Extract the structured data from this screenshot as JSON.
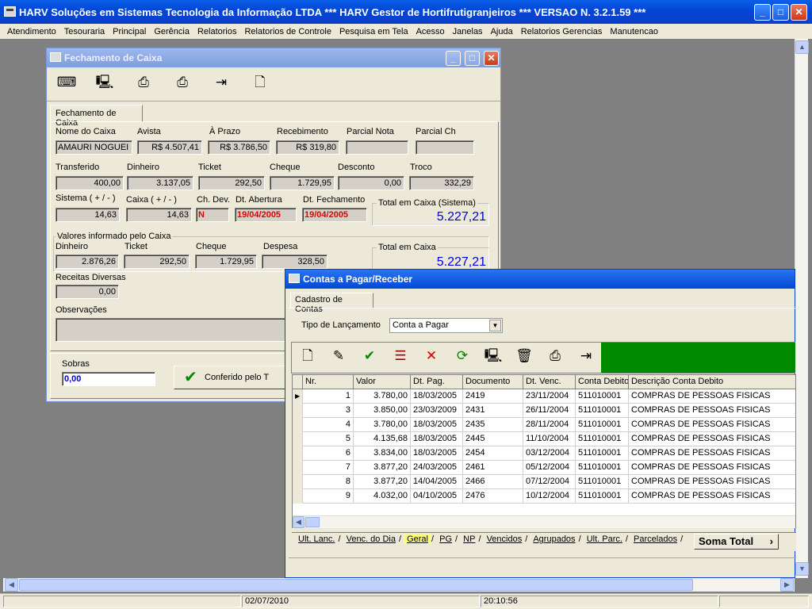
{
  "app": {
    "title": "HARV Soluções em Sistemas Tecnologia da Informação LTDA *** HARV Gestor de Hortifrutigranjeiros *** VERSAO N. 3.2.1.59 ***",
    "min_label": "_",
    "max_label": "□",
    "close_label": "✕"
  },
  "menu": [
    "Atendimento",
    "Tesouraria",
    "Principal",
    "Gerência",
    "Relatorios",
    "Relatorios de Controle",
    "Pesquisa em Tela",
    "Acesso",
    "Janelas",
    "Ajuda",
    "Relatorios Gerencias",
    "Manutencao"
  ],
  "fechamento": {
    "title": "Fechamento de Caixa",
    "tab": "Fechamento de Caixa",
    "labels": {
      "nome_caixa": "Nome do Caixa",
      "avista": "Avista",
      "aprazo": "À Prazo",
      "recebimento": "Recebimento",
      "parcial_nota": "Parcial Nota",
      "parcial_ch": "Parcial Ch",
      "transferido": "Transferido",
      "dinheiro": "Dinheiro",
      "ticket": "Ticket",
      "cheque": "Cheque",
      "desconto": "Desconto",
      "troco": "Troco",
      "sistema": "Sistema ( + / - )",
      "caixa": "Caixa ( + / - )",
      "ch_dev": "Ch. Dev.",
      "dt_abertura": "Dt. Abertura",
      "dt_fechamento": "Dt. Fechamento",
      "total_sistema": "Total em Caixa (Sistema)",
      "valores_info": "Valores informado pelo Caixa",
      "v_dinheiro": "Dinheiro",
      "v_ticket": "Ticket",
      "v_cheque": "Cheque",
      "v_despesa": "Despesa",
      "total_caixa": "Total em Caixa",
      "receitas": "Receitas Diversas",
      "observacoes": "Observações",
      "sobras": "Sobras"
    },
    "values": {
      "nome_caixa": "AMAURI NOGUEI",
      "avista": "R$ 4.507,41",
      "aprazo": "R$ 3.786,50",
      "recebimento": "R$ 319,80",
      "parcial_nota": "",
      "parcial_ch": "",
      "transferido": "400,00",
      "dinheiro": "3.137,05",
      "ticket": "292,50",
      "cheque": "1.729,95",
      "desconto": "0,00",
      "troco": "332,29",
      "sistema": "14,63",
      "caixa": "14,63",
      "ch_dev": "N",
      "dt_abertura": "19/04/2005",
      "dt_fechamento": "19/04/2005",
      "total_sistema": "5.227,21",
      "v_dinheiro": "2.876,26",
      "v_ticket": "292,50",
      "v_cheque": "1.729,95",
      "v_despesa": "328,50",
      "total_caixa": "5.227,21",
      "receitas": "0,00",
      "observacoes": "",
      "sobras": "0,00"
    },
    "conferido_label": "Conferido pelo T"
  },
  "contas": {
    "title": "Contas a Pagar/Receber",
    "tab": "Cadastro de Contas",
    "tipo_label": "Tipo de Lançamento",
    "tipo_value": "Conta a Pagar",
    "columns": [
      "Nr.",
      "Valor",
      "Dt. Pag.",
      "Documento",
      "Dt. Venc.",
      "Conta Debito",
      "Descrição Conta Debito"
    ],
    "rows": [
      [
        "1",
        "3.780,00",
        "18/03/2005",
        "2419",
        "23/11/2004",
        "511010001",
        "COMPRAS DE PESSOAS FISICAS"
      ],
      [
        "3",
        "3.850,00",
        "23/03/2009",
        "2431",
        "26/11/2004",
        "511010001",
        "COMPRAS DE PESSOAS FISICAS"
      ],
      [
        "4",
        "3.780,00",
        "18/03/2005",
        "2435",
        "28/11/2004",
        "511010001",
        "COMPRAS DE PESSOAS FISICAS"
      ],
      [
        "5",
        "4.135,68",
        "18/03/2005",
        "2445",
        "11/10/2004",
        "511010001",
        "COMPRAS DE PESSOAS FISICAS"
      ],
      [
        "6",
        "3.834,00",
        "18/03/2005",
        "2454",
        "03/12/2004",
        "511010001",
        "COMPRAS DE PESSOAS FISICAS"
      ],
      [
        "7",
        "3.877,20",
        "24/03/2005",
        "2461",
        "05/12/2004",
        "511010001",
        "COMPRAS DE PESSOAS FISICAS"
      ],
      [
        "8",
        "3.877,20",
        "14/04/2005",
        "2466",
        "07/12/2004",
        "511010001",
        "COMPRAS DE PESSOAS FISICAS"
      ],
      [
        "9",
        "4.032,00",
        "04/10/2005",
        "2476",
        "10/12/2004",
        "511010001",
        "COMPRAS DE PESSOAS FISICAS"
      ]
    ],
    "bottom_tabs": [
      "Ult. Lanc.",
      "Venc. do Dia",
      "Geral",
      "PG",
      "NP",
      "Vencidos",
      "Agrupados",
      "Ult. Parc.",
      "Parcelados"
    ],
    "active_tab": "Geral",
    "soma_total": "Soma Total"
  },
  "status": {
    "date": "02/07/2010",
    "time": "20:10:56"
  },
  "colors": {
    "title_blue": "#0a4fd8",
    "accent_green": "#008a00",
    "value_blue": "#0000e0",
    "value_red": "#e00000"
  }
}
